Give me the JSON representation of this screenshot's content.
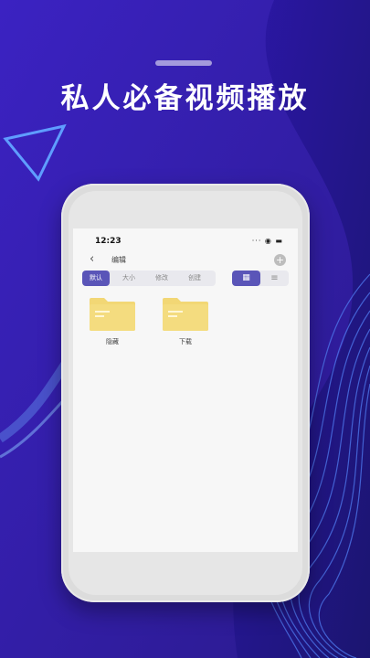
{
  "headline": "私人必备视频播放",
  "status": {
    "time": "12:23",
    "icons": "···  ◉ ▬"
  },
  "navbar": {
    "back_icon": "‹",
    "title": "编辑",
    "add_icon": "+"
  },
  "sort_tabs": [
    {
      "label": "默认",
      "active": true
    },
    {
      "label": "大小",
      "active": false
    },
    {
      "label": "修改",
      "active": false
    },
    {
      "label": "创建",
      "active": false
    }
  ],
  "view_toggle": {
    "grid_icon": "▦",
    "list_icon": "≡"
  },
  "folders": [
    {
      "label": "隐藏",
      "icon": "folder-icon"
    },
    {
      "label": "下载",
      "icon": "folder-icon"
    }
  ],
  "colors": {
    "background": "#3a1fb8",
    "accent": "#5a55b8",
    "folder": "#f2d775"
  }
}
